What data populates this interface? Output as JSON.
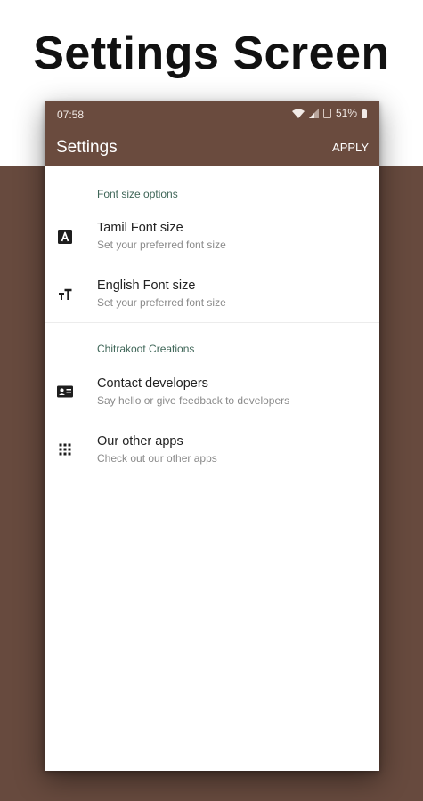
{
  "promo": {
    "title": "Settings Screen"
  },
  "status_bar": {
    "time": "07:58",
    "battery": "51%"
  },
  "app_bar": {
    "title": "Settings",
    "action": "APPLY"
  },
  "sections": [
    {
      "header": "Font size options",
      "items": [
        {
          "icon": "font-a-icon",
          "title": "Tamil Font size",
          "summary": "Set your preferred font size"
        },
        {
          "icon": "text-size-icon",
          "title": "English Font size",
          "summary": "Set your preferred font size"
        }
      ]
    },
    {
      "header": "Chitrakoot Creations",
      "items": [
        {
          "icon": "contact-card-icon",
          "title": "Contact developers",
          "summary": "Say hello or give feedback to developers"
        },
        {
          "icon": "apps-grid-icon",
          "title": "Our other apps",
          "summary": "Check out our other apps"
        }
      ]
    }
  ],
  "colors": {
    "primary": "#6a4b3e",
    "background_band": "#674a3e",
    "accent_text": "#3f6658"
  }
}
